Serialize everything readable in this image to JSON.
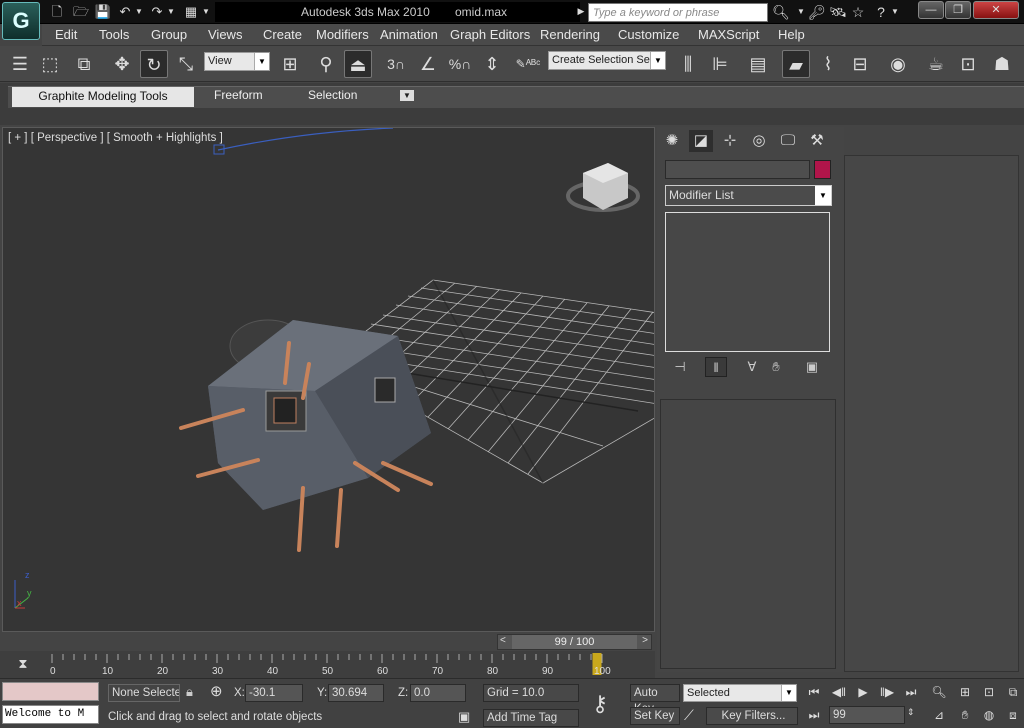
{
  "window": {
    "app_title": "Autodesk 3ds Max  2010",
    "file_name": "omid.max"
  },
  "search": {
    "placeholder": "Type a keyword or phrase"
  },
  "menubar": [
    "Edit",
    "Tools",
    "Group",
    "Views",
    "Create",
    "Modifiers",
    "Animation",
    "Graph Editors",
    "Rendering",
    "Customize",
    "MAXScript",
    "Help"
  ],
  "toolbar": {
    "reference_coord": "View",
    "selection_set": "Create Selection Se"
  },
  "ribbon": {
    "tabs": [
      "Graphite Modeling Tools",
      "Freeform",
      "Selection"
    ]
  },
  "viewport": {
    "label": "[ + ] [ Perspective ] [ Smooth + Highlights ]",
    "axis_x": "x",
    "axis_y": "y",
    "axis_z": "z"
  },
  "command_panel": {
    "modifier_list": "Modifier List",
    "color": "#b0154a"
  },
  "timeline": {
    "frame_display": "99 / 100",
    "current_frame": 99,
    "max_frame": 100,
    "ticks": [
      "0",
      "10",
      "20",
      "30",
      "40",
      "50",
      "60",
      "70",
      "80",
      "90",
      "100"
    ]
  },
  "status": {
    "selection": "None Selected",
    "x_label": "X:",
    "x_value": "-30.1",
    "y_label": "Y:",
    "y_value": "30.694",
    "z_label": "Z:",
    "z_value": "0.0",
    "grid": "Grid = 10.0",
    "prompt": "Click and drag to select and rotate objects",
    "add_time_tag": "Add Time Tag",
    "listener": "Welcome to M"
  },
  "anim": {
    "auto_key": "Auto Key",
    "set_key": "Set Key",
    "key_mode": "Selected",
    "key_filters": "Key Filters...",
    "frame_field": "99"
  }
}
